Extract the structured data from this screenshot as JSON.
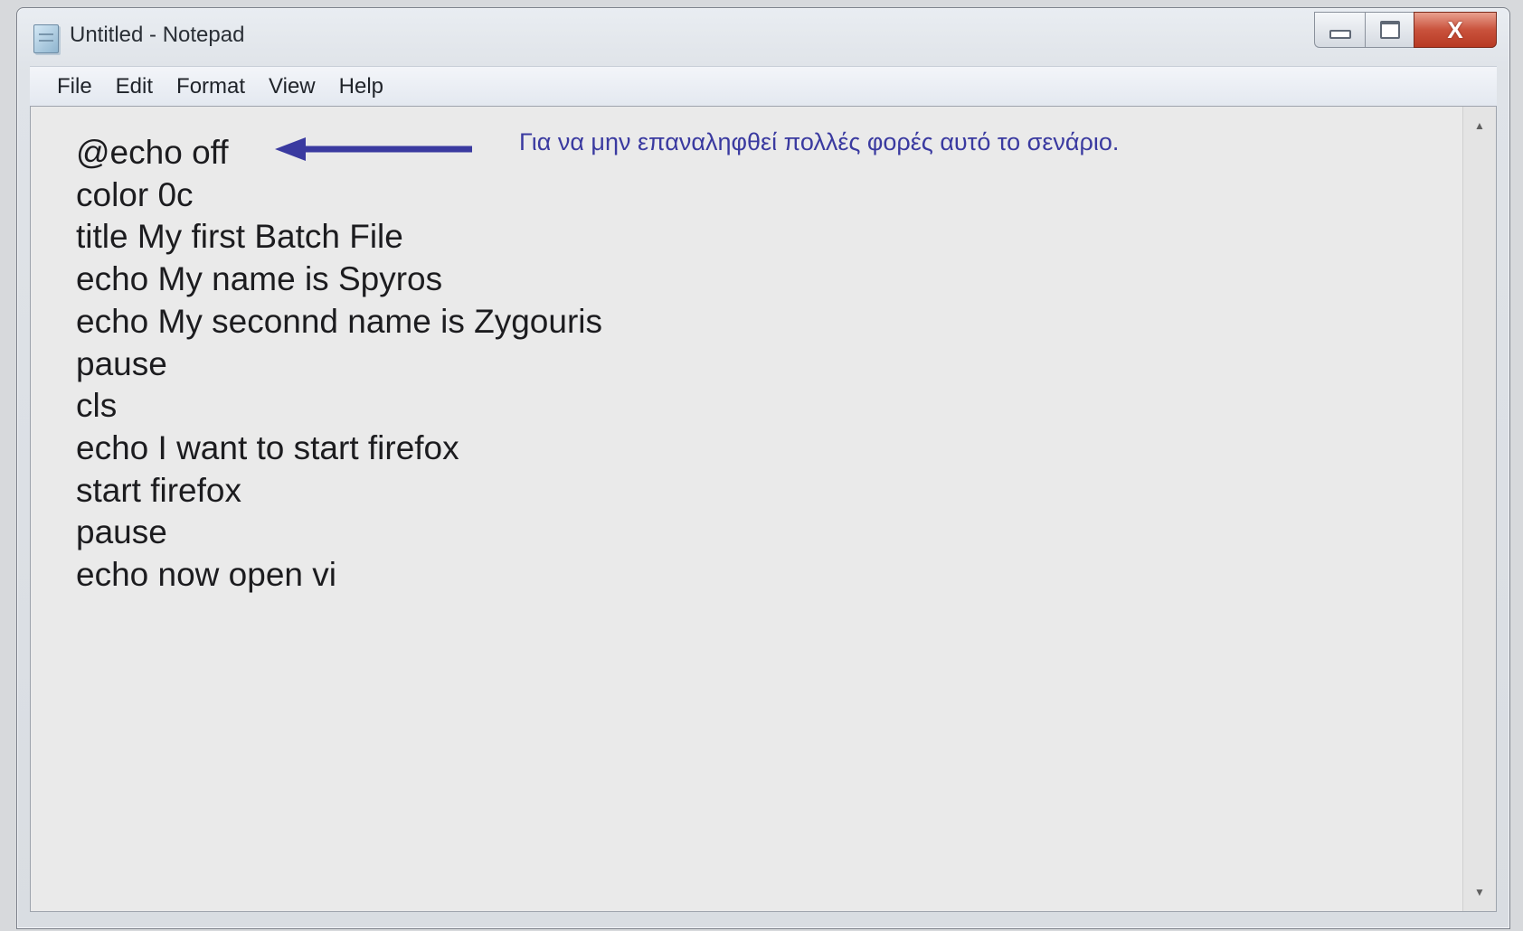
{
  "window": {
    "title": "Untitled - Notepad",
    "icon": "notepad-icon"
  },
  "controls": {
    "close_glyph": "X"
  },
  "menu": {
    "items": [
      "File",
      "Edit",
      "Format",
      "View",
      "Help"
    ]
  },
  "editor": {
    "lines": [
      "@echo off",
      "color 0c",
      "title My first Batch File",
      "echo My name is Spyros",
      "echo My seconnd name is Zygouris",
      "pause",
      "cls",
      "echo I want to start firefox",
      "start firefox",
      "pause",
      "echo now open vi"
    ]
  },
  "annotation": {
    "text": "Για να μην επαναληφθεί πολλές φορές αυτό το σενάριο.",
    "color": "#3a3aa0"
  }
}
